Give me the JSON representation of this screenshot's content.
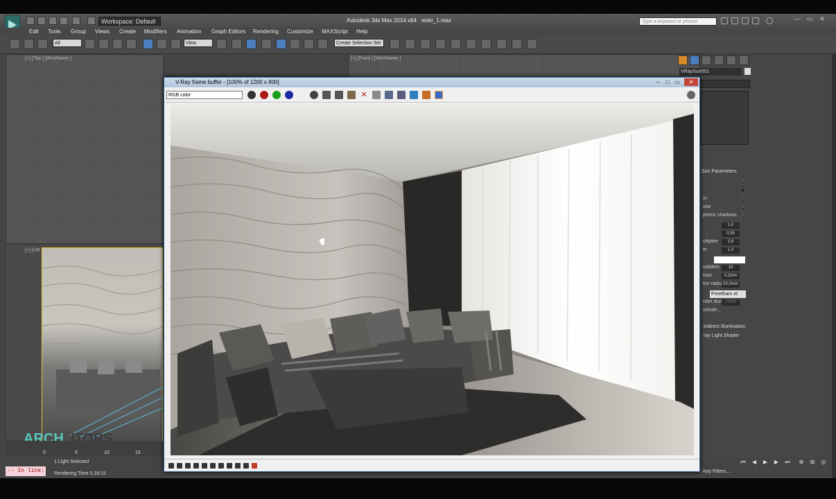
{
  "app": {
    "title": "Autodesk 3ds Max 2014 x64",
    "file": "wokr_1.max",
    "workspace": "Workspace: Default",
    "search_placeholder": "Type a keyword or phrase"
  },
  "menu": [
    "Edit",
    "Tools",
    "Group",
    "Views",
    "Create",
    "Modifiers",
    "Animation",
    "Graph Editors",
    "Rendering",
    "Customize",
    "MAXScript",
    "Help"
  ],
  "toolbar": {
    "selection_filter": "All",
    "ref_coord": "View",
    "named_selection": "Create Selection Set"
  },
  "viewports": {
    "top": "[+] [Top ] [Wireframe ]",
    "front": "[+] [Front ] [Wireframe ]",
    "persp": "[+] [VR"
  },
  "vfb": {
    "title": "V-Ray frame buffer - [100% of 1200 x 800]",
    "channel": "RGB color"
  },
  "status": {
    "selected": "1 Light Selected",
    "render_time": "Rendering Time  0:18:15",
    "maxscript": "-- In line:",
    "timeline_ticks": [
      "0",
      "5",
      "10",
      "15"
    ]
  },
  "watermark": {
    "part1": "ARCH",
    "part2": "ITORS"
  },
  "command_panel": {
    "object_name": "VRaySun001",
    "rollout_title": "Sun Parameters",
    "rows": [
      {
        "label": "",
        "value": "",
        "check": "✓"
      },
      {
        "label": "",
        "value": "",
        "check": ""
      },
      {
        "label": "ın",
        "value": "",
        "check": "✓"
      },
      {
        "label": "ular",
        "value": "",
        "check": "✓"
      },
      {
        "label": "pheric shadows",
        "value": "",
        "check": "✓"
      },
      {
        "label": "",
        "value": "1,0",
        "check": ""
      },
      {
        "label": "",
        "value": "0,35",
        "check": ""
      },
      {
        "label": "ultiplier",
        "value": "0,8",
        "check": ""
      },
      {
        "label": "er",
        "value": "1,0",
        "check": ""
      }
    ],
    "rows2": [
      {
        "label": "subdivs",
        "value": "10"
      },
      {
        "label": "bias",
        "value": "0,2mm"
      },
      {
        "label": "ton radius",
        "value": "50,0mm"
      }
    ],
    "sky_model": "Preetham et",
    "rows3": [
      {
        "label": "ndirt illum",
        "value": "25000"
      },
      {
        "label": "xclude...",
        "value": ""
      }
    ],
    "buttons": [
      "Indirect Illumination",
      "ray Light Shader"
    ],
    "filter": "Key Filters..."
  },
  "colors": {
    "accent": "#4c7fbf",
    "persp_border": "#e3c53a",
    "watermark": "#58c7b8"
  }
}
